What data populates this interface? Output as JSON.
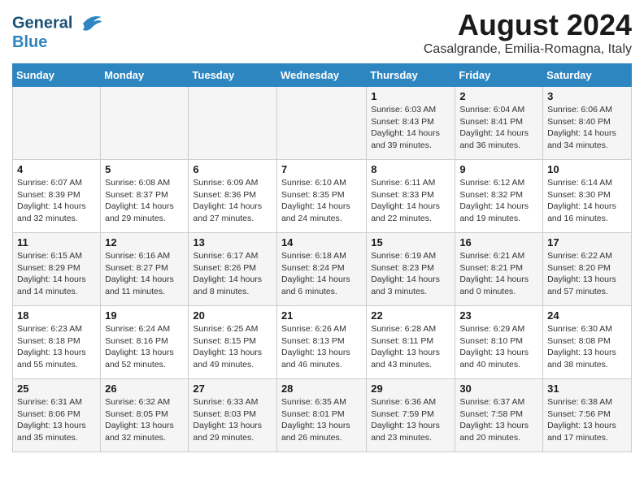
{
  "logo": {
    "line1": "General",
    "line2": "Blue"
  },
  "title": "August 2024",
  "subtitle": "Casalgrande, Emilia-Romagna, Italy",
  "days_of_week": [
    "Sunday",
    "Monday",
    "Tuesday",
    "Wednesday",
    "Thursday",
    "Friday",
    "Saturday"
  ],
  "weeks": [
    [
      {
        "day": "",
        "info": ""
      },
      {
        "day": "",
        "info": ""
      },
      {
        "day": "",
        "info": ""
      },
      {
        "day": "",
        "info": ""
      },
      {
        "day": "1",
        "info": "Sunrise: 6:03 AM\nSunset: 8:43 PM\nDaylight: 14 hours\nand 39 minutes."
      },
      {
        "day": "2",
        "info": "Sunrise: 6:04 AM\nSunset: 8:41 PM\nDaylight: 14 hours\nand 36 minutes."
      },
      {
        "day": "3",
        "info": "Sunrise: 6:06 AM\nSunset: 8:40 PM\nDaylight: 14 hours\nand 34 minutes."
      }
    ],
    [
      {
        "day": "4",
        "info": "Sunrise: 6:07 AM\nSunset: 8:39 PM\nDaylight: 14 hours\nand 32 minutes."
      },
      {
        "day": "5",
        "info": "Sunrise: 6:08 AM\nSunset: 8:37 PM\nDaylight: 14 hours\nand 29 minutes."
      },
      {
        "day": "6",
        "info": "Sunrise: 6:09 AM\nSunset: 8:36 PM\nDaylight: 14 hours\nand 27 minutes."
      },
      {
        "day": "7",
        "info": "Sunrise: 6:10 AM\nSunset: 8:35 PM\nDaylight: 14 hours\nand 24 minutes."
      },
      {
        "day": "8",
        "info": "Sunrise: 6:11 AM\nSunset: 8:33 PM\nDaylight: 14 hours\nand 22 minutes."
      },
      {
        "day": "9",
        "info": "Sunrise: 6:12 AM\nSunset: 8:32 PM\nDaylight: 14 hours\nand 19 minutes."
      },
      {
        "day": "10",
        "info": "Sunrise: 6:14 AM\nSunset: 8:30 PM\nDaylight: 14 hours\nand 16 minutes."
      }
    ],
    [
      {
        "day": "11",
        "info": "Sunrise: 6:15 AM\nSunset: 8:29 PM\nDaylight: 14 hours\nand 14 minutes."
      },
      {
        "day": "12",
        "info": "Sunrise: 6:16 AM\nSunset: 8:27 PM\nDaylight: 14 hours\nand 11 minutes."
      },
      {
        "day": "13",
        "info": "Sunrise: 6:17 AM\nSunset: 8:26 PM\nDaylight: 14 hours\nand 8 minutes."
      },
      {
        "day": "14",
        "info": "Sunrise: 6:18 AM\nSunset: 8:24 PM\nDaylight: 14 hours\nand 6 minutes."
      },
      {
        "day": "15",
        "info": "Sunrise: 6:19 AM\nSunset: 8:23 PM\nDaylight: 14 hours\nand 3 minutes."
      },
      {
        "day": "16",
        "info": "Sunrise: 6:21 AM\nSunset: 8:21 PM\nDaylight: 14 hours\nand 0 minutes."
      },
      {
        "day": "17",
        "info": "Sunrise: 6:22 AM\nSunset: 8:20 PM\nDaylight: 13 hours\nand 57 minutes."
      }
    ],
    [
      {
        "day": "18",
        "info": "Sunrise: 6:23 AM\nSunset: 8:18 PM\nDaylight: 13 hours\nand 55 minutes."
      },
      {
        "day": "19",
        "info": "Sunrise: 6:24 AM\nSunset: 8:16 PM\nDaylight: 13 hours\nand 52 minutes."
      },
      {
        "day": "20",
        "info": "Sunrise: 6:25 AM\nSunset: 8:15 PM\nDaylight: 13 hours\nand 49 minutes."
      },
      {
        "day": "21",
        "info": "Sunrise: 6:26 AM\nSunset: 8:13 PM\nDaylight: 13 hours\nand 46 minutes."
      },
      {
        "day": "22",
        "info": "Sunrise: 6:28 AM\nSunset: 8:11 PM\nDaylight: 13 hours\nand 43 minutes."
      },
      {
        "day": "23",
        "info": "Sunrise: 6:29 AM\nSunset: 8:10 PM\nDaylight: 13 hours\nand 40 minutes."
      },
      {
        "day": "24",
        "info": "Sunrise: 6:30 AM\nSunset: 8:08 PM\nDaylight: 13 hours\nand 38 minutes."
      }
    ],
    [
      {
        "day": "25",
        "info": "Sunrise: 6:31 AM\nSunset: 8:06 PM\nDaylight: 13 hours\nand 35 minutes."
      },
      {
        "day": "26",
        "info": "Sunrise: 6:32 AM\nSunset: 8:05 PM\nDaylight: 13 hours\nand 32 minutes."
      },
      {
        "day": "27",
        "info": "Sunrise: 6:33 AM\nSunset: 8:03 PM\nDaylight: 13 hours\nand 29 minutes."
      },
      {
        "day": "28",
        "info": "Sunrise: 6:35 AM\nSunset: 8:01 PM\nDaylight: 13 hours\nand 26 minutes."
      },
      {
        "day": "29",
        "info": "Sunrise: 6:36 AM\nSunset: 7:59 PM\nDaylight: 13 hours\nand 23 minutes."
      },
      {
        "day": "30",
        "info": "Sunrise: 6:37 AM\nSunset: 7:58 PM\nDaylight: 13 hours\nand 20 minutes."
      },
      {
        "day": "31",
        "info": "Sunrise: 6:38 AM\nSunset: 7:56 PM\nDaylight: 13 hours\nand 17 minutes."
      }
    ]
  ]
}
